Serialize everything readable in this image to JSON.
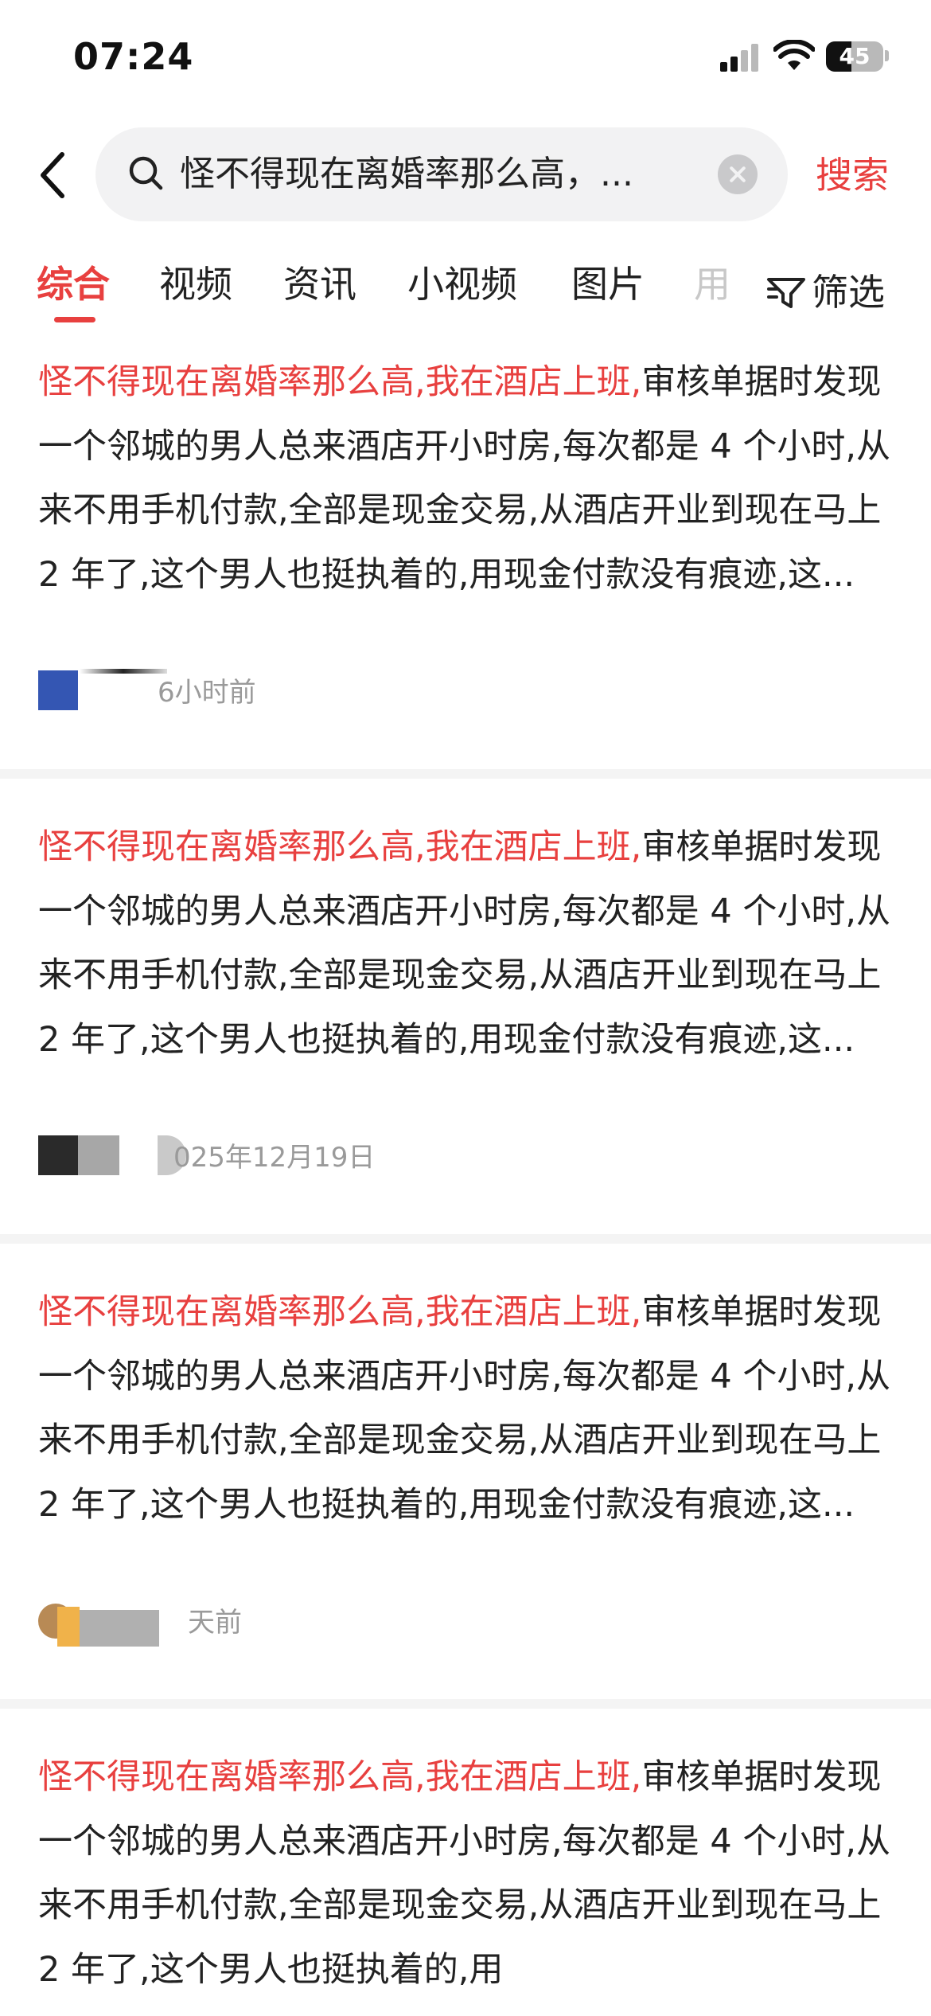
{
  "status_bar": {
    "time": "07:24",
    "battery": "45",
    "battery_level": 0.45
  },
  "search": {
    "query": "怪不得现在离婚率那么高，...",
    "submit_label": "搜索"
  },
  "tabs": [
    {
      "label": "综合",
      "active": true
    },
    {
      "label": "视频"
    },
    {
      "label": "资讯"
    },
    {
      "label": "小视频"
    },
    {
      "label": "图片"
    },
    {
      "label": "用"
    }
  ],
  "filter_label": "筛选",
  "results": [
    {
      "highlight": "怪不得现在离婚率那么高,我在酒店上班,",
      "body": "审核单据时发现一个邻城的男人总来酒店开小时房,每次都是 4 个小时,从来不用手机付款,全部是现金交易,从酒店开业到现在马上 2 年了,这个男人也挺执着的,用现金付款没有痕迹,这...",
      "time": "6小时前"
    },
    {
      "highlight": "怪不得现在离婚率那么高,我在酒店上班,",
      "body": "审核单据时发现一个邻城的男人总来酒店开小时房,每次都是 4 个小时,从来不用手机付款,全部是现金交易,从酒店开业到现在马上 2 年了,这个男人也挺执着的,用现金付款没有痕迹,这...",
      "time": "025年12月19日"
    },
    {
      "highlight": "怪不得现在离婚率那么高,我在酒店上班,",
      "body": "审核单据时发现一个邻城的男人总来酒店开小时房,每次都是 4 个小时,从来不用手机付款,全部是现金交易,从酒店开业到现在马上 2 年了,这个男人也挺执着的,用现金付款没有痕迹,这...",
      "time": "天前"
    },
    {
      "highlight": "怪不得现在离婚率那么高,我在酒店上班,",
      "body": "审核单据时发现一个邻城的男人总来酒店开小时房,每次都是 4 个小时,从来不用手机付款,全部是现金交易,从酒店开业到现在马上 2 年了,这个男人也挺执着的,用"
    }
  ]
}
